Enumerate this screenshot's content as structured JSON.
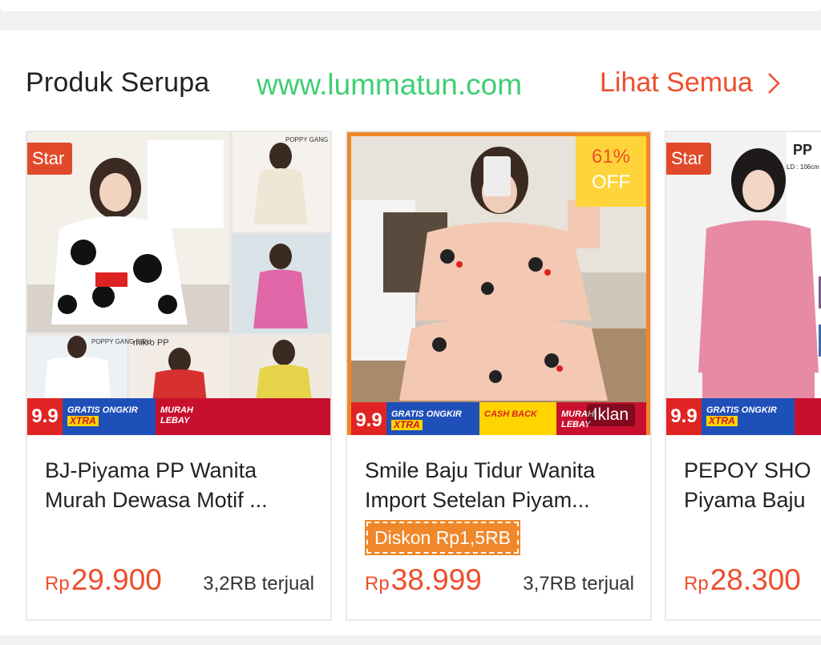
{
  "header": {
    "title": "Produk Serupa",
    "watermark": "www.lummatun.com",
    "see_all": "Lihat Semua"
  },
  "products": [
    {
      "badge": "Star",
      "name_line1": "BJ-Piyama PP Wanita",
      "name_line2": "Murah Dewasa Motif ...",
      "price_currency": "Rp",
      "price": "29.900",
      "sold": "3,2RB terjual",
      "promo": {
        "nine": "9.9",
        "gratis": "GRATIS ONGKIR",
        "xtra": "XTRA",
        "murah": "MURAH LEBAY"
      },
      "image_labels": {
        "a": "POPPY GANG KREM",
        "b": "POPPY GANG BIRU",
        "c": "mikro PP"
      }
    },
    {
      "off_percent": "61%",
      "off_label": "OFF",
      "name_line1": "Smile Baju Tidur Wanita",
      "name_line2": "Import Setelan Piyam...",
      "discount": "Diskon Rp1,5RB",
      "price_currency": "Rp",
      "price": "38.999",
      "sold": "3,7RB terjual",
      "ad_label": "Iklan",
      "promo": {
        "nine": "9.9",
        "gratis": "GRATIS ONGKIR",
        "xtra": "XTRA",
        "cash": "CASH BACK",
        "murah": "MURAH LEBAY"
      }
    },
    {
      "badge": "Star",
      "name_line1": "PEPOY SHO",
      "name_line2": "Piyama Baju",
      "price_currency": "Rp",
      "price": "28.300",
      "promo": {
        "nine": "9.9",
        "gratis": "GRATIS ONGKIR",
        "xtra": "XTRA"
      },
      "image_labels": {
        "a": "PP",
        "b": "LD : 106cm"
      }
    }
  ],
  "colors": {
    "accent": "#ee4d2d",
    "watermark": "#3ecf73",
    "promo_blue": "#1f4fb8",
    "promo_red": "#c8102e",
    "promo_yellow": "#ffd400"
  }
}
